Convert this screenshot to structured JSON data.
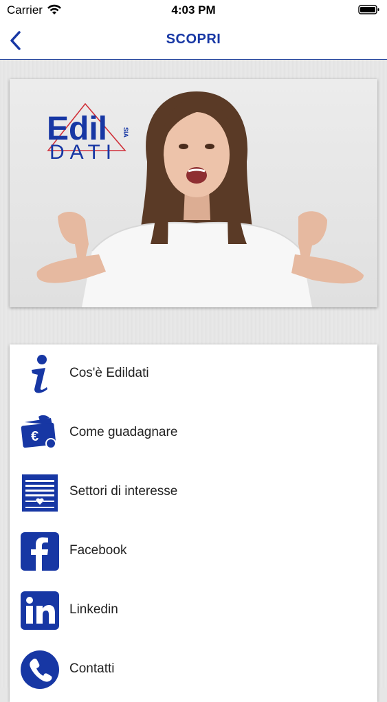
{
  "status_bar": {
    "carrier": "Carrier",
    "time": "4:03 PM"
  },
  "nav": {
    "title": "SCOPRI",
    "back_icon": "chevron-left-icon"
  },
  "banner": {
    "logo_top": "Edil",
    "logo_bottom": "DATI",
    "logo_suffix": "SIA"
  },
  "menu": {
    "items": [
      {
        "label": "Cos'è Edildati",
        "icon": "info-icon"
      },
      {
        "label": "Come guadagnare",
        "icon": "wallet-euro-icon"
      },
      {
        "label": "Settori di interesse",
        "icon": "document-heart-icon"
      },
      {
        "label": "Facebook",
        "icon": "facebook-icon"
      },
      {
        "label": "Linkedin",
        "icon": "linkedin-icon"
      },
      {
        "label": "Contatti",
        "icon": "phone-icon"
      }
    ]
  },
  "colors": {
    "brand_blue": "#1737a4",
    "logo_red": "#d0313a"
  }
}
